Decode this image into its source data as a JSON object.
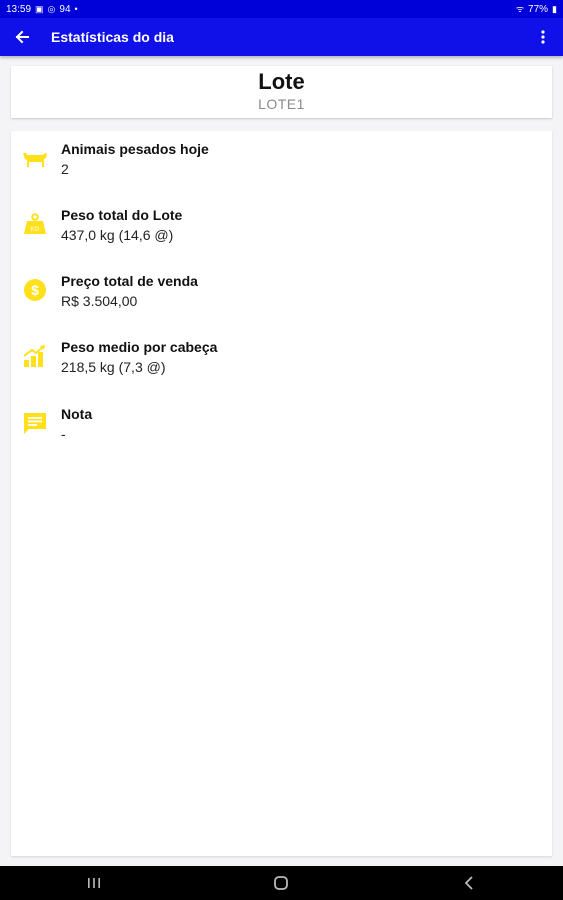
{
  "status_bar": {
    "time": "13:59",
    "indicator": "94",
    "battery": "77%"
  },
  "app_bar": {
    "title": "Estatísticas do dia"
  },
  "header": {
    "title": "Lote",
    "subtitle": "LOTE1"
  },
  "stats": [
    {
      "icon": "cow-icon",
      "label": "Animais pesados hoje",
      "value": "2"
    },
    {
      "icon": "weight-icon",
      "label": "Peso total do Lote",
      "value": "437,0 kg (14,6 @)"
    },
    {
      "icon": "dollar-coin-icon",
      "label": "Preço total de venda",
      "value": "R$ 3.504,00"
    },
    {
      "icon": "bar-chart-icon",
      "label": "Peso medio por cabeça",
      "value": "218,5 kg (7,3 @)"
    },
    {
      "icon": "note-icon",
      "label": "Nota",
      "value": "-"
    }
  ],
  "colors": {
    "status_bar": "#0000d9",
    "app_bar": "#1010e8",
    "icon_yellow": "#ffe01b",
    "nav_bar": "#000000"
  }
}
